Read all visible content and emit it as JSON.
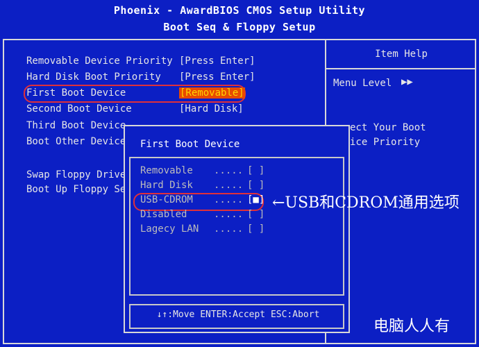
{
  "header": {
    "title": "Phoenix - AwardBIOS CMOS Setup Utility",
    "subtitle": "Boot Seq & Floppy Setup"
  },
  "settings": [
    {
      "label": "Removable Device Priority",
      "value": "[Press Enter]"
    },
    {
      "label": "Hard Disk Boot Priority",
      "value": "[Press Enter]"
    },
    {
      "label": "First Boot Device",
      "value": "[Removable]"
    },
    {
      "label": "Second Boot Device",
      "value": "[Hard Disk]"
    },
    {
      "label": "Third Boot Device",
      "value": ""
    },
    {
      "label": "Boot Other Device",
      "value": ""
    },
    {
      "label": "Swap Floppy Drive",
      "value": ""
    },
    {
      "label": "Boot Up Floppy Se",
      "value": ""
    }
  ],
  "help": {
    "title": "Item Help",
    "menu_level_label": "Menu Level",
    "menu_level_arrows": "▶▶",
    "line1": "ect Your Boot",
    "line2": "ice Priority"
  },
  "popup": {
    "title": "First Boot Device",
    "dots": ".....",
    "options": [
      {
        "label": "Removable",
        "box": "[ ]"
      },
      {
        "label": "Hard Disk",
        "box": "[ ]"
      },
      {
        "label": "USB-CDROM",
        "box": "[■]"
      },
      {
        "label": "Disabled",
        "box": "[ ]"
      },
      {
        "label": "Lagecy LAN",
        "box": "[ ]"
      }
    ],
    "hint": "↓↑:Move ENTER:Accept ESC:Abort"
  },
  "annotation": "←USB和CDROM通用选项",
  "watermark": "电脑人人有",
  "colors": {
    "background": "#0c1fc4",
    "highlight_bg": "#e84a00",
    "highlight_text": "#ffd400",
    "annotation_ring": "#e0303a"
  }
}
